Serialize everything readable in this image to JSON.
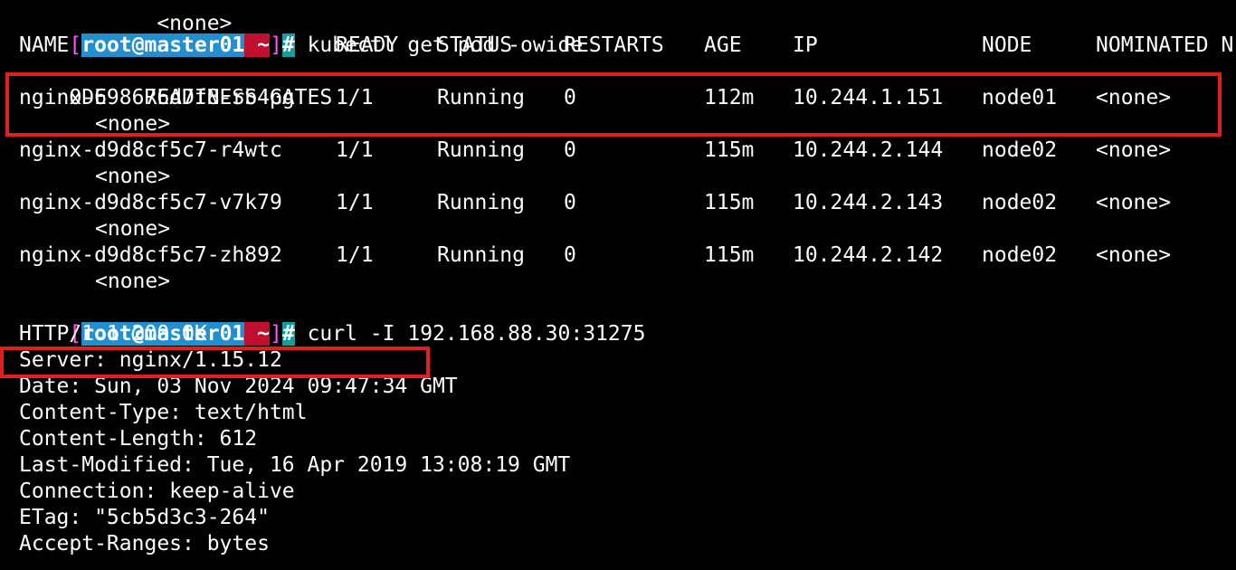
{
  "terminal": {
    "top_partial": "       <none>",
    "prompt1": {
      "open": "[",
      "user": "root",
      "at": "@",
      "host": "master01",
      "space": " ",
      "dir": "~",
      "close": "]",
      "hash": "#",
      "command": " kubectl get pod -owide"
    },
    "pod_header": {
      "name": "NAME",
      "ready": "READY",
      "status": "STATUS",
      "restarts": "RESTARTS",
      "age": "AGE",
      "ip": "IP",
      "node": "NODE",
      "nominated": "NOMINATED N",
      "wrap": "ODE   READINESS GATES"
    },
    "pods": [
      {
        "name": "nginx-698676d7f8-rb4pg",
        "ready": "1/1",
        "status": "Running",
        "restarts": "0",
        "age": "112m",
        "ip": "10.244.1.151",
        "node": "node01",
        "nominated": "<none>",
        "gates": "<none>"
      },
      {
        "name": "nginx-d9d8cf5c7-r4wtc",
        "ready": "1/1",
        "status": "Running",
        "restarts": "0",
        "age": "115m",
        "ip": "10.244.2.144",
        "node": "node02",
        "nominated": "<none>",
        "gates": "<none>"
      },
      {
        "name": "nginx-d9d8cf5c7-v7k79",
        "ready": "1/1",
        "status": "Running",
        "restarts": "0",
        "age": "115m",
        "ip": "10.244.2.143",
        "node": "node02",
        "nominated": "<none>",
        "gates": "<none>"
      },
      {
        "name": "nginx-d9d8cf5c7-zh892",
        "ready": "1/1",
        "status": "Running",
        "restarts": "0",
        "age": "115m",
        "ip": "10.244.2.142",
        "node": "node02",
        "nominated": "<none>",
        "gates": "<none>"
      }
    ],
    "prompt2": {
      "open": "[",
      "user": "root",
      "at": "@",
      "host": "master01",
      "space": " ",
      "dir": "~",
      "close": "]",
      "hash": "#",
      "command": " curl -I 192.168.88.30:31275"
    },
    "http_response": [
      "HTTP/1.1 200 OK",
      "Server: nginx/1.15.12",
      "Date: Sun, 03 Nov 2024 09:47:34 GMT",
      "Content-Type: text/html",
      "Content-Length: 612",
      "Last-Modified: Tue, 16 Apr 2019 13:08:19 GMT",
      "Connection: keep-alive",
      "ETag: \"5cb5d3c3-264\"",
      "Accept-Ranges: bytes"
    ]
  },
  "colors": {
    "background": "#000000",
    "text": "#ffffff",
    "highlight": "#e02020",
    "prompt_blue": "#2090d0",
    "prompt_red": "#c01030",
    "prompt_cyan": "#10a0a0",
    "prompt_magenta": "#ff55ff"
  }
}
